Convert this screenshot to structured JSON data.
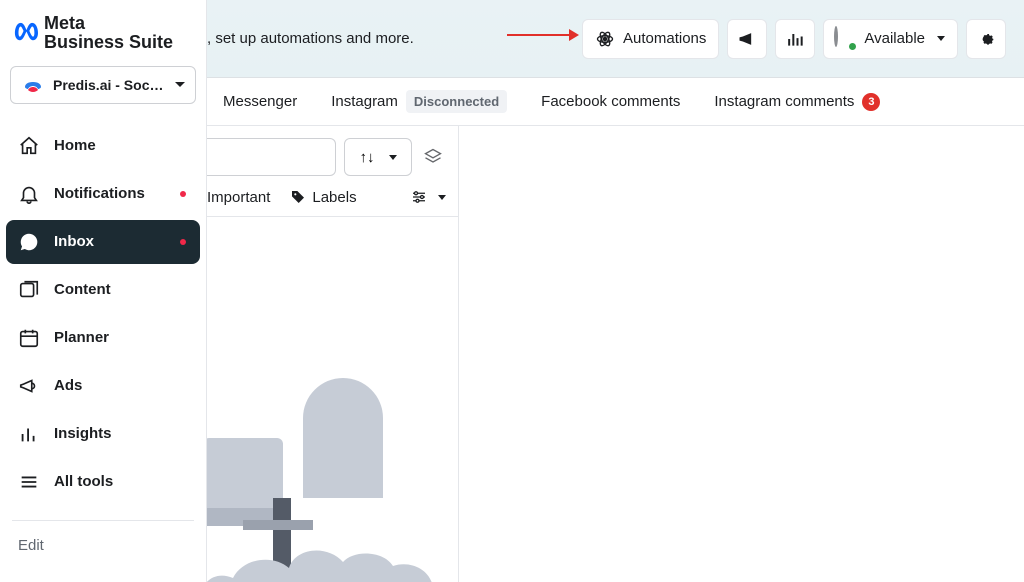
{
  "brand": {
    "line1": "Meta",
    "line2": "Business Suite"
  },
  "account": {
    "name": "Predis.ai - Social ..."
  },
  "nav": {
    "home": "Home",
    "notifications": "Notifications",
    "inbox": "Inbox",
    "content": "Content",
    "planner": "Planner",
    "ads": "Ads",
    "insights": "Insights",
    "alltools": "All tools"
  },
  "edit_label": "Edit",
  "topbar": {
    "partial_text": ", set up automations and more.",
    "automations": "Automations",
    "status_label": "Available"
  },
  "tabs": {
    "messenger": "Messenger",
    "instagram": "Instagram",
    "disconnected": "Disconnected",
    "fb_comments": "Facebook comments",
    "ig_comments": "Instagram comments",
    "ig_comments_badge": "3"
  },
  "filters": {
    "important": "Important",
    "labels": "Labels"
  }
}
